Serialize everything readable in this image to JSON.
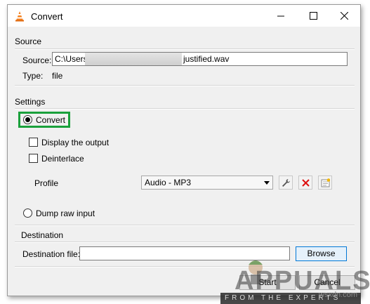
{
  "window": {
    "title": "Convert",
    "minimize_glyph": "minimize-icon",
    "maximize_glyph": "maximize-icon",
    "close_glyph": "close-icon"
  },
  "source": {
    "group_title": "Source",
    "source_label": "Source:",
    "path_prefix": "C:\\Users",
    "path_suffix": "justified.wav",
    "type_label": "Type:",
    "type_value": "file"
  },
  "settings": {
    "group_title": "Settings",
    "convert_label": "Convert",
    "convert_selected": true,
    "display_output_label": "Display the output",
    "display_output_checked": false,
    "deinterlace_label": "Deinterlace",
    "deinterlace_checked": false,
    "profile_label": "Profile",
    "profile_value": "Audio - MP3",
    "dump_raw_label": "Dump raw input",
    "dump_raw_selected": false
  },
  "destination": {
    "group_title": "Destination",
    "file_label": "Destination file:",
    "file_value": "",
    "browse_label": "Browse"
  },
  "footer": {
    "start_label": "Start",
    "cancel_label": "Cancel"
  },
  "watermark": {
    "brand": "APPUALS",
    "tagline": "FROM THE EXPERTS",
    "site": "wsxdn.com"
  },
  "colors": {
    "highlight": "#1aa03b",
    "window_bg": "#f0f0f0",
    "default_button_border": "#0078d7"
  }
}
